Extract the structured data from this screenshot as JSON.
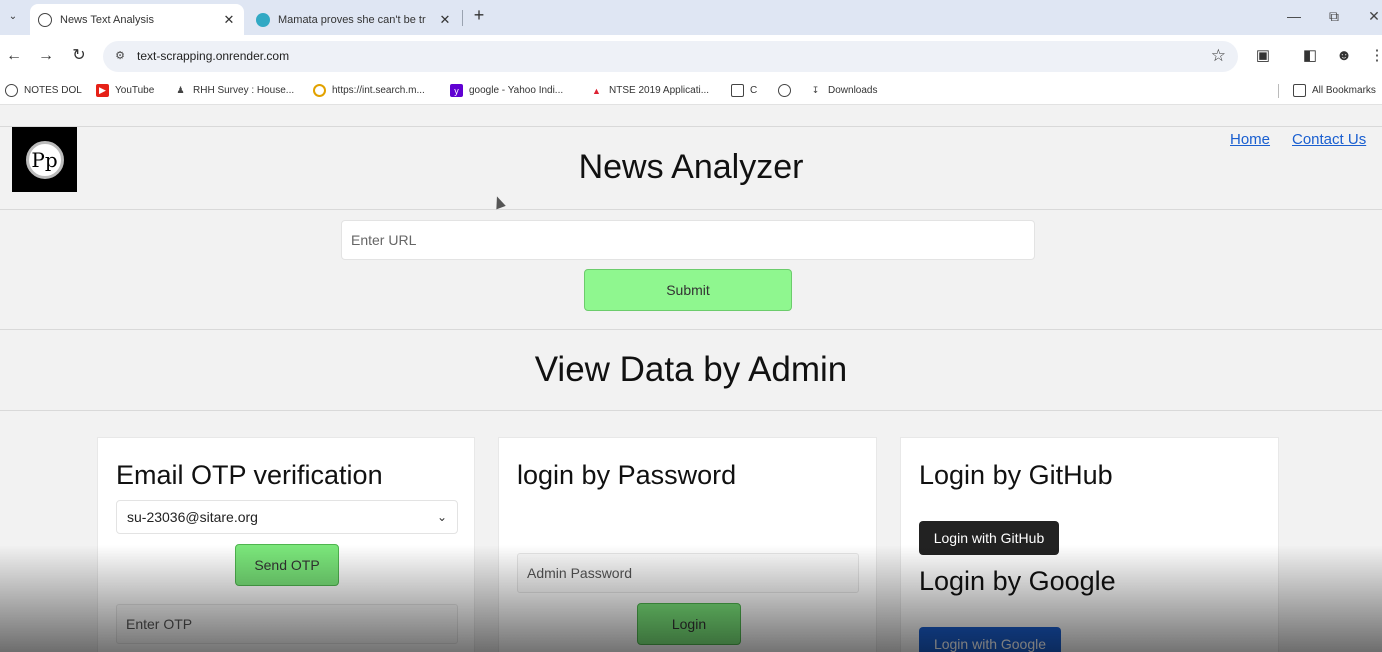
{
  "browser": {
    "tabs": [
      {
        "title": "News Text Analysis",
        "active": true
      },
      {
        "title": "Mamata proves she can't be tr",
        "active": false
      }
    ],
    "new_tab": "+",
    "address": "text-scrapping.onrender.com",
    "bookmarks": [
      "NOTES DOL",
      "YouTube",
      "RHH Survey : House...",
      "https://int.search.m...",
      "google - Yahoo Indi...",
      "NTSE 2019 Applicati...",
      "C",
      "Downloads"
    ],
    "all_bookmarks": "All Bookmarks"
  },
  "header": {
    "logo_text": "Pp",
    "title": "News Analyzer",
    "nav": [
      {
        "label": "Home"
      },
      {
        "label": "Contact Us"
      }
    ]
  },
  "analyzer": {
    "url_placeholder": "Enter URL",
    "submit_label": "Submit"
  },
  "admin": {
    "title": "View Data by Admin",
    "email_card": {
      "title": "Email OTP verification",
      "selected_email": "su-23036@sitare.org",
      "send_label": "Send OTP",
      "otp_placeholder": "Enter OTP"
    },
    "password_card": {
      "title": "login by Password",
      "password_placeholder": "Admin Password",
      "login_label": "Login"
    },
    "oauth_card": {
      "github_title": "Login by GitHub",
      "github_button": "Login with GitHub",
      "google_title": "Login by Google",
      "google_button": "Login with Google"
    }
  },
  "colors": {
    "submit_green": "#8ff78f",
    "button_green": "#7be77b",
    "link_blue": "#1a5fd0",
    "github_dark": "#222222",
    "google_blue": "#1a5fd0"
  }
}
